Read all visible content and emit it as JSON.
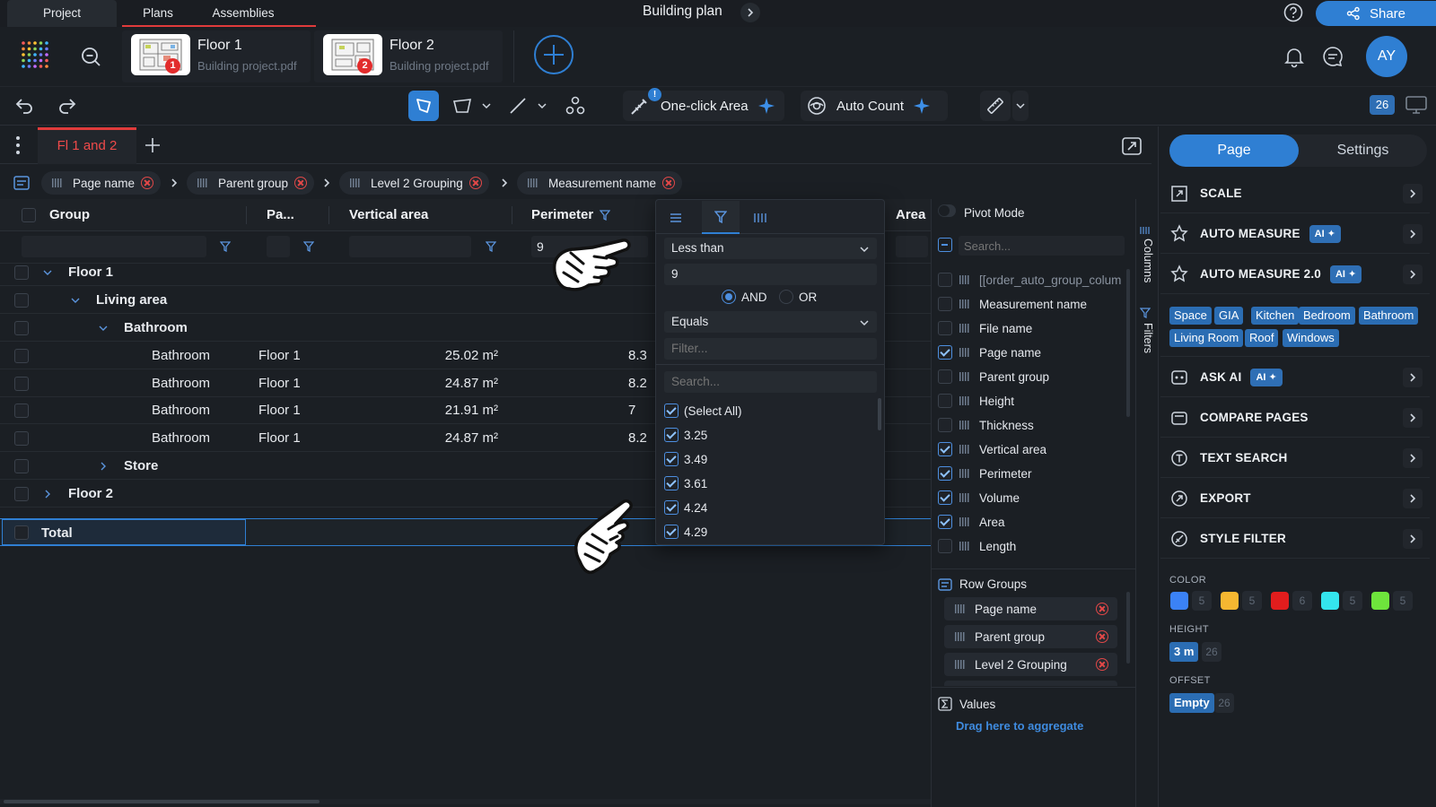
{
  "project_tabs": {
    "project": "Project",
    "plans": "Plans",
    "assemblies": "Assemblies"
  },
  "document_title": "Building plan",
  "share_label": "Share",
  "avatar_initials": "AY",
  "files": [
    {
      "name": "Floor 1",
      "source": "Building project.pdf",
      "badge": "1"
    },
    {
      "name": "Floor 2",
      "source": "Building project.pdf",
      "badge": "2"
    }
  ],
  "toolbar": {
    "one_click_area": "One-click Area",
    "one_click_alert": "!",
    "auto_count": "Auto Count",
    "counter": "26"
  },
  "sheet_tab": "Fl 1 and 2",
  "group_chips": [
    "Page name",
    "Parent group",
    "Level 2 Grouping",
    "Measurement name"
  ],
  "grid": {
    "headers": {
      "group": "Group",
      "parent": "Pa...",
      "vertical_area": "Vertical area",
      "perimeter": "Perimeter",
      "area": "Area"
    },
    "perimeter_filter_value": "9",
    "rows": [
      {
        "label": "Floor 1"
      },
      {
        "label": "Living area"
      },
      {
        "label": "Bathroom"
      },
      {
        "label": "Bathroom",
        "page": "Floor 1",
        "vertical_area": "25.02 m²",
        "perimeter": "8.3"
      },
      {
        "label": "Bathroom",
        "page": "Floor 1",
        "vertical_area": "24.87 m²",
        "perimeter": "8.2"
      },
      {
        "label": "Bathroom",
        "page": "Floor 1",
        "vertical_area": "21.91 m²",
        "perimeter": "7"
      },
      {
        "label": "Bathroom",
        "page": "Floor 1",
        "vertical_area": "24.87 m²",
        "perimeter": "8.2"
      },
      {
        "label": "Store"
      },
      {
        "label": "Floor 2"
      }
    ],
    "total": "Total"
  },
  "filter_popup": {
    "condition1": "Less than",
    "value1": "9",
    "and": "AND",
    "or": "OR",
    "condition2": "Equals",
    "filter_placeholder": "Filter...",
    "search_placeholder": "Search...",
    "options": [
      "(Select All)",
      "3.25",
      "3.49",
      "3.61",
      "4.24",
      "4.29"
    ]
  },
  "columns_panel": {
    "pivot_mode": "Pivot Mode",
    "search_placeholder": "Search...",
    "vertical_tab_columns": "Columns",
    "vertical_tab_filters": "Filters",
    "columns": [
      {
        "name": "[[order_auto_group_colum",
        "checked": false
      },
      {
        "name": "Measurement name",
        "checked": false
      },
      {
        "name": "File name",
        "checked": false
      },
      {
        "name": "Page name",
        "checked": true
      },
      {
        "name": "Parent group",
        "checked": false
      },
      {
        "name": "Height",
        "checked": false
      },
      {
        "name": "Thickness",
        "checked": false
      },
      {
        "name": "Vertical area",
        "checked": true
      },
      {
        "name": "Perimeter",
        "checked": true
      },
      {
        "name": "Volume",
        "checked": true
      },
      {
        "name": "Area",
        "checked": true
      },
      {
        "name": "Length",
        "checked": false
      }
    ],
    "row_groups_title": "Row Groups",
    "row_groups": [
      "Page name",
      "Parent group",
      "Level 2 Grouping"
    ],
    "values_title": "Values",
    "values_hint": "Drag here to aggregate"
  },
  "right_panel": {
    "tabs": {
      "page": "Page",
      "settings": "Settings"
    },
    "sections": [
      {
        "title": "SCALE",
        "ai": false
      },
      {
        "title": "AUTO MEASURE",
        "ai": true
      },
      {
        "title": "AUTO MEASURE 2.0",
        "ai": true
      }
    ],
    "ai_label": "AI",
    "tags": [
      "Space",
      "GIA",
      "Kitchen",
      "Bedroom",
      "Bathroom",
      "Living Room",
      "Roof",
      "Windows"
    ],
    "sections2": [
      {
        "title": "ASK AI",
        "ai": true
      },
      {
        "title": "COMPARE PAGES",
        "ai": false
      },
      {
        "title": "TEXT SEARCH",
        "ai": false
      },
      {
        "title": "EXPORT",
        "ai": false
      },
      {
        "title": "STYLE FILTER",
        "ai": false
      }
    ],
    "color_label": "COLOR",
    "colors": [
      {
        "hex": "#3b82f6",
        "count": "5"
      },
      {
        "hex": "#f5b731",
        "count": "5"
      },
      {
        "hex": "#e11d1d",
        "count": "6"
      },
      {
        "hex": "#34e5ee",
        "count": "5"
      },
      {
        "hex": "#6ee43c",
        "count": "5"
      }
    ],
    "height_label": "HEIGHT",
    "height_value": "3 m",
    "height_count": "26",
    "offset_label": "OFFSET",
    "offset_value": "Empty",
    "offset_count": "26"
  },
  "accent": "#2f7fd3"
}
